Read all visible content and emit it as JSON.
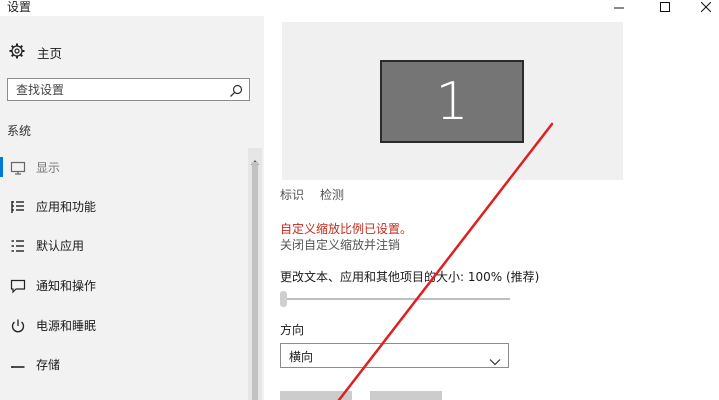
{
  "window": {
    "title": "设置",
    "controls": [
      "minimize",
      "maximize",
      "close"
    ]
  },
  "sidebar": {
    "home_label": "主页",
    "search_placeholder": "查找设置",
    "section_label": "系统",
    "items": [
      {
        "label": "显示",
        "icon": "monitor-icon",
        "active": true
      },
      {
        "label": "应用和功能",
        "icon": "apps-list-icon",
        "active": false
      },
      {
        "label": "默认应用",
        "icon": "default-apps-icon",
        "active": false
      },
      {
        "label": "通知和操作",
        "icon": "notification-icon",
        "active": false
      },
      {
        "label": "电源和睡眠",
        "icon": "power-icon",
        "active": false
      },
      {
        "label": "存储",
        "icon": "storage-icon",
        "active": false
      }
    ]
  },
  "display": {
    "monitor_number": "1",
    "identify_link": "标识",
    "detect_link": "检测",
    "custom_scale_warning": "自定义缩放比例已设置。",
    "undo_link": "关闭自定义缩放并注销",
    "scale_label": "更改文本、应用和其他项目的大小: 100% (推荐)",
    "scale_level": 0,
    "orientation_label": "方向",
    "orientation_value": "横向"
  },
  "colors": {
    "accent": "#0078d7",
    "warning": "#c42b1c",
    "annotation_arrow": "#e02020",
    "sidebar_bg": "#f2f2f2"
  }
}
